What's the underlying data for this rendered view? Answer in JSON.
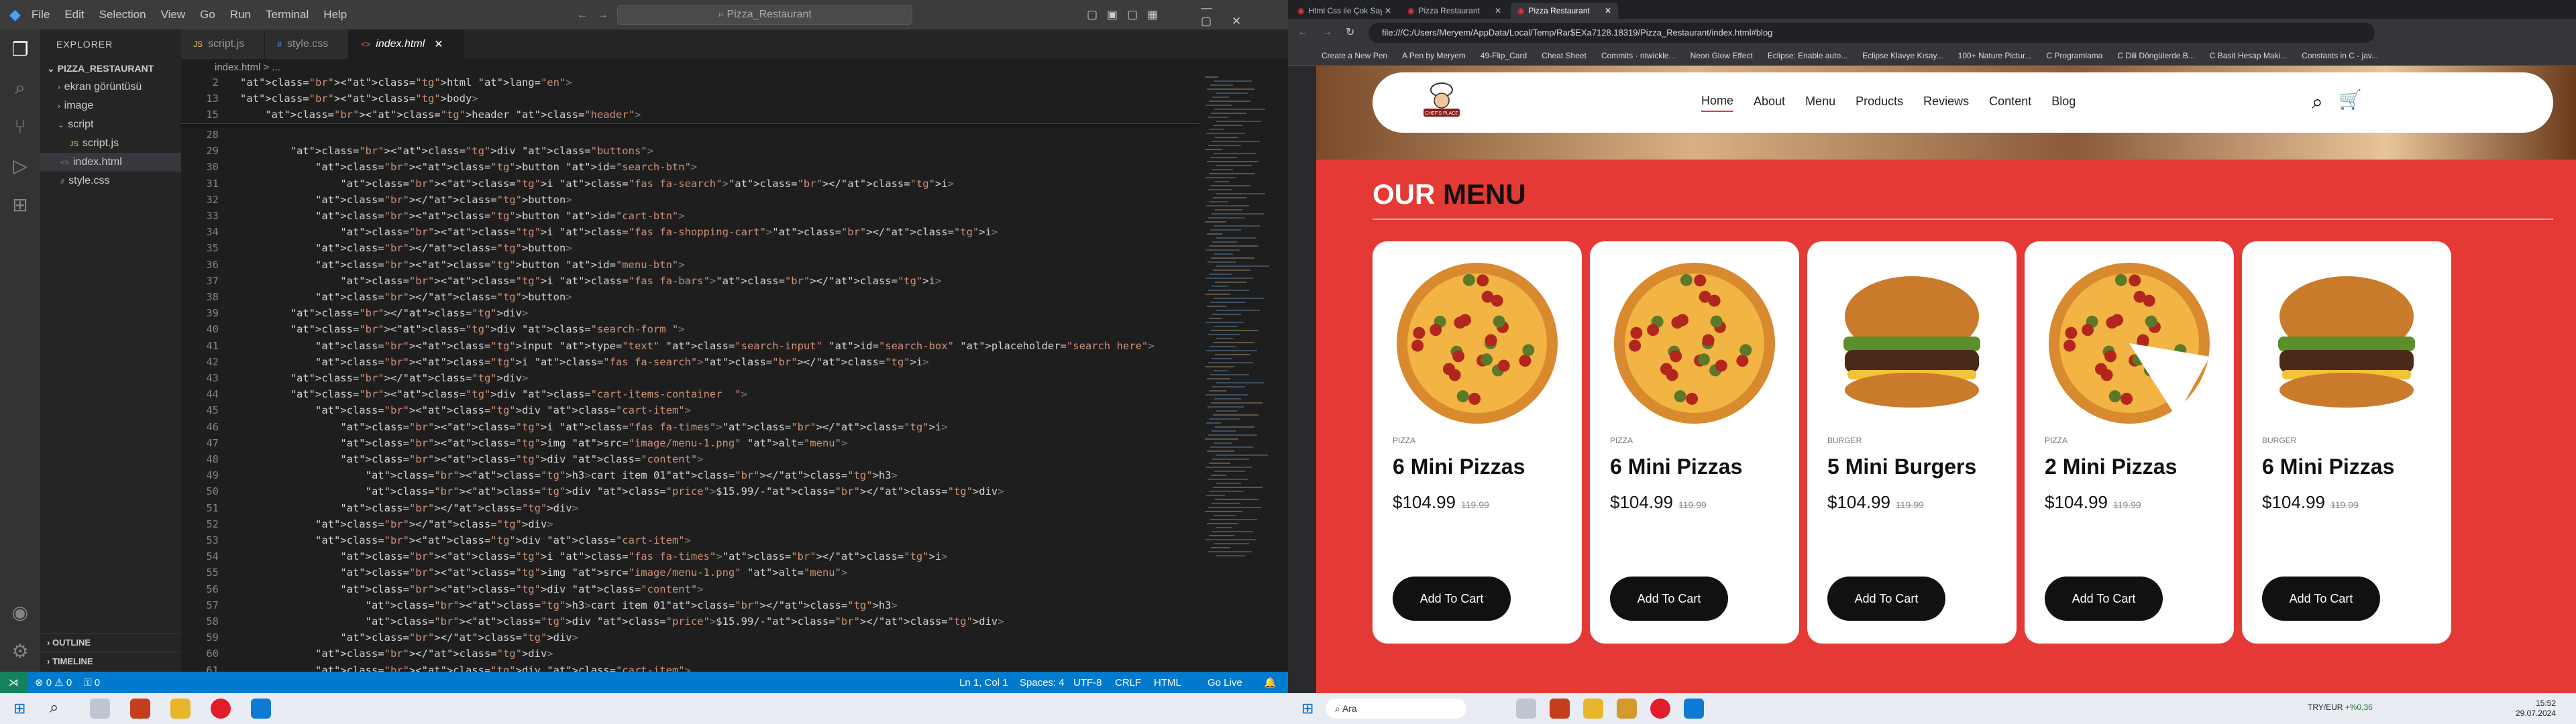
{
  "vscode": {
    "menu": [
      "File",
      "Edit",
      "Selection",
      "View",
      "Go",
      "Run",
      "Terminal",
      "Help"
    ],
    "search": "Pizza_Restaurant",
    "explorer_title": "EXPLORER",
    "project": "PIZZA_RESTAURANT",
    "tree": [
      "ekran görüntüsü",
      "image",
      "script",
      "script.js",
      "index.html",
      "style.css"
    ],
    "outline": "OUTLINE",
    "timeline": "TIMELINE",
    "tabs": [
      "script.js",
      "style.css",
      "index.html"
    ],
    "breadcrumb": "index.html > ...",
    "code_lines": [
      {
        "n": "2",
        "t": "<html lang=\"en\">"
      },
      {
        "n": "13",
        "t": "<body>"
      },
      {
        "n": "15",
        "t": "    <header class=\"header\">"
      },
      {
        "n": "28",
        "t": ""
      },
      {
        "n": "29",
        "t": "        <div class=\"buttons\">"
      },
      {
        "n": "30",
        "t": "            <button id=\"search-btn\">"
      },
      {
        "n": "31",
        "t": "                <i class=\"fas fa-search\"></i>"
      },
      {
        "n": "32",
        "t": "            </button>"
      },
      {
        "n": "33",
        "t": "            <button id=\"cart-btn\">"
      },
      {
        "n": "34",
        "t": "                <i class=\"fas fa-shopping-cart\"></i>"
      },
      {
        "n": "35",
        "t": "            </button>"
      },
      {
        "n": "36",
        "t": "            <button id=\"menu-btn\">"
      },
      {
        "n": "37",
        "t": "                <i class=\"fas fa-bars\"></i>"
      },
      {
        "n": "38",
        "t": "            </button>"
      },
      {
        "n": "39",
        "t": "        </div>"
      },
      {
        "n": "40",
        "t": "        <div class=\"search-form \">"
      },
      {
        "n": "41",
        "t": "            <input type=\"text\" class=\"search-input\" id=\"search-box\" placeholder=\"search here\">"
      },
      {
        "n": "42",
        "t": "            <i class=\"fas fa-search\"></i>"
      },
      {
        "n": "43",
        "t": "        </div>"
      },
      {
        "n": "44",
        "t": "        <div class=\"cart-items-container  \">"
      },
      {
        "n": "45",
        "t": "            <div class=\"cart-item\">"
      },
      {
        "n": "46",
        "t": "                <i class=\"fas fa-times\"></i>"
      },
      {
        "n": "47",
        "t": "                <img src=\"image/menu-1.png\" alt=\"menu\">"
      },
      {
        "n": "48",
        "t": "                <div class=\"content\">"
      },
      {
        "n": "49",
        "t": "                    <h3>cart item 01</h3>"
      },
      {
        "n": "50",
        "t": "                    <div class=\"price\">$15.99/-</div>"
      },
      {
        "n": "51",
        "t": "                </div>"
      },
      {
        "n": "52",
        "t": "            </div>"
      },
      {
        "n": "53",
        "t": "            <div class=\"cart-item\">"
      },
      {
        "n": "54",
        "t": "                <i class=\"fas fa-times\"></i>"
      },
      {
        "n": "55",
        "t": "                <img src=\"image/menu-1.png\" alt=\"menu\">"
      },
      {
        "n": "56",
        "t": "                <div class=\"content\">"
      },
      {
        "n": "57",
        "t": "                    <h3>cart item 01</h3>"
      },
      {
        "n": "58",
        "t": "                    <div class=\"price\">$15.99/-</div>"
      },
      {
        "n": "59",
        "t": "                </div>"
      },
      {
        "n": "60",
        "t": "            </div>"
      },
      {
        "n": "61",
        "t": "            <div class=\"cart-item\">"
      },
      {
        "n": "62",
        "t": ""
      }
    ],
    "status": {
      "errors": "⊗ 0 ⚠ 0",
      "ports": "⚿ 0",
      "position": "Ln 1, Col 1",
      "spaces": "Spaces: 4",
      "encoding": "UTF-8",
      "eol": "CRLF",
      "language": "HTML",
      "golive": "Go Live"
    }
  },
  "browser": {
    "tabs": [
      "Html Css ile Çok Sayfalı P...",
      "Pizza Restaurant",
      "Pizza Restaurant"
    ],
    "url": "file:///C:/Users/Meryem/AppData/Local/Temp/Rar$EXa7128.18319/Pizza_Restaurant/index.html#blog",
    "bookmarks": [
      "Create a New Pen",
      "A Pen by Meryem",
      "49-Flip_Card",
      "Cheat Sheet",
      "Commits · ntwickle...",
      "Neon Glow Effect",
      "Eclipse: Enable auto...",
      "Eclipse Klavye Kısay...",
      "100+ Nature Pictur...",
      "C Programlama",
      "C Dili Döngülerde B...",
      "C Basit Hesap Maki...",
      "Constants in C - jav..."
    ],
    "site": {
      "logo_text": "CHEF'S PLACE",
      "nav": [
        "Home",
        "About",
        "Menu",
        "Products",
        "Reviews",
        "Content",
        "Blog"
      ],
      "section_title_a": "OUR",
      "section_title_b": "MENU",
      "cards": [
        {
          "cat": "PIZZA",
          "name": "6 Mini Pizzas",
          "price": "$104.99",
          "old": "119.99",
          "btn": "Add To Cart",
          "kind": "pizza"
        },
        {
          "cat": "PIZZA",
          "name": "6 Mini Pizzas",
          "price": "$104.99",
          "old": "119.99",
          "btn": "Add To Cart",
          "kind": "pizza"
        },
        {
          "cat": "BURGER",
          "name": "5 Mini Burgers",
          "price": "$104.99",
          "old": "119.99",
          "btn": "Add To Cart",
          "kind": "burger"
        },
        {
          "cat": "PIZZA",
          "name": "2 Mini Pizzas",
          "price": "$104.99",
          "old": "119.99",
          "btn": "Add To Cart",
          "kind": "pizza-slice"
        },
        {
          "cat": "BURGER",
          "name": "6 Mini Pizzas",
          "price": "$104.99",
          "old": "119.99",
          "btn": "Add To Cart",
          "kind": "burger"
        }
      ]
    }
  },
  "taskbar": {
    "search_left": "Ara",
    "search_right": "Ara",
    "currency": "TRY/EUR",
    "change": "+%0,36",
    "time": "15:52",
    "date": "29.07.2024"
  }
}
